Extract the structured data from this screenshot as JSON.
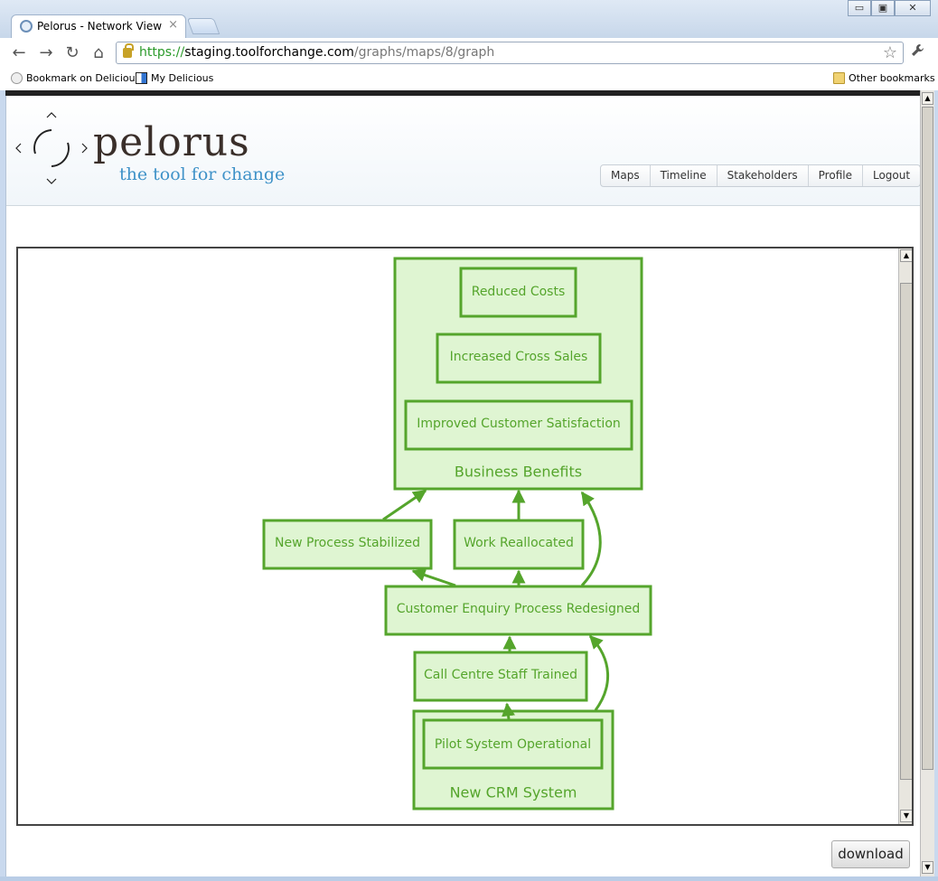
{
  "browser": {
    "tab_title": "Pelorus - Network View",
    "url_scheme": "https://",
    "url_host": "staging.toolforchange.com",
    "url_path": "/graphs/maps/8/graph",
    "bookmarks": [
      "Bookmark on Delicious",
      "My Delicious"
    ],
    "other_bookmarks": "Other bookmarks",
    "icons": {
      "back": "←",
      "forward": "→",
      "reload": "↻",
      "home": "⌂",
      "star": "☆",
      "wrench": "🔧",
      "close": "×",
      "minimize": "▭",
      "maximize": "▣",
      "window_close": "✕"
    }
  },
  "header": {
    "brand": "pelorus",
    "tagline": "the tool for change",
    "nav": [
      "Maps",
      "Timeline",
      "Stakeholders",
      "Profile",
      "Logout"
    ]
  },
  "graph": {
    "colors": {
      "stroke": "#55a52c",
      "fill": "#dff5d2",
      "text": "#55a52c"
    },
    "nodes": [
      {
        "id": "business-benefits",
        "label": "Business Benefits",
        "group": true
      },
      {
        "id": "reduced-costs",
        "label": "Reduced Costs"
      },
      {
        "id": "increased-cross-sales",
        "label": "Increased Cross Sales"
      },
      {
        "id": "improved-customer-satisfaction",
        "label": "Improved Customer Satisfaction"
      },
      {
        "id": "new-process-stabilized",
        "label": "New Process Stabilized"
      },
      {
        "id": "work-reallocated",
        "label": "Work Reallocated"
      },
      {
        "id": "customer-enquiry-process-redesigned",
        "label": "Customer Enquiry Process Redesigned"
      },
      {
        "id": "call-centre-staff-trained",
        "label": "Call Centre Staff Trained"
      },
      {
        "id": "new-crm-system",
        "label": "New CRM System",
        "group": true
      },
      {
        "id": "pilot-system-operational",
        "label": "Pilot System Operational"
      }
    ],
    "edges": [
      [
        "new-process-stabilized",
        "business-benefits"
      ],
      [
        "work-reallocated",
        "business-benefits"
      ],
      [
        "customer-enquiry-process-redesigned",
        "business-benefits"
      ],
      [
        "customer-enquiry-process-redesigned",
        "new-process-stabilized"
      ],
      [
        "customer-enquiry-process-redesigned",
        "work-reallocated"
      ],
      [
        "call-centre-staff-trained",
        "customer-enquiry-process-redesigned"
      ],
      [
        "new-crm-system",
        "customer-enquiry-process-redesigned"
      ],
      [
        "pilot-system-operational",
        "call-centre-staff-trained"
      ]
    ]
  },
  "download_label": "download"
}
